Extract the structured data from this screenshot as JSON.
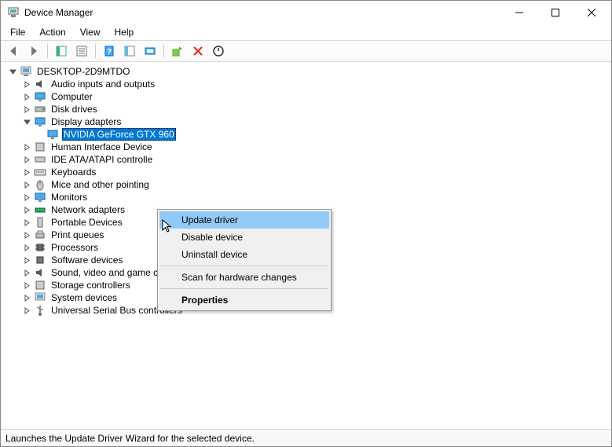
{
  "window": {
    "title": "Device Manager"
  },
  "menubar": {
    "file": "File",
    "action": "Action",
    "view": "View",
    "help": "Help"
  },
  "tree": {
    "root": "DESKTOP-2D9MTDO",
    "items": {
      "audio": "Audio inputs and outputs",
      "computer": "Computer",
      "disk": "Disk drives",
      "display": "Display adapters",
      "gpu": "NVIDIA GeForce GTX 960",
      "hid": "Human Interface Device",
      "ide": "IDE ATA/ATAPI controlle",
      "keyboards": "Keyboards",
      "mice": "Mice and other pointing",
      "monitors": "Monitors",
      "network": "Network adapters",
      "portable": "Portable Devices",
      "printqueues": "Print queues",
      "processors": "Processors",
      "software": "Software devices",
      "sound": "Sound, video and game controllers",
      "storage": "Storage controllers",
      "system": "System devices",
      "usb": "Universal Serial Bus controllers"
    }
  },
  "context_menu": {
    "update": "Update driver",
    "disable": "Disable device",
    "uninstall": "Uninstall device",
    "scan": "Scan for hardware changes",
    "properties": "Properties"
  },
  "statusbar": {
    "text": "Launches the Update Driver Wizard for the selected device."
  }
}
